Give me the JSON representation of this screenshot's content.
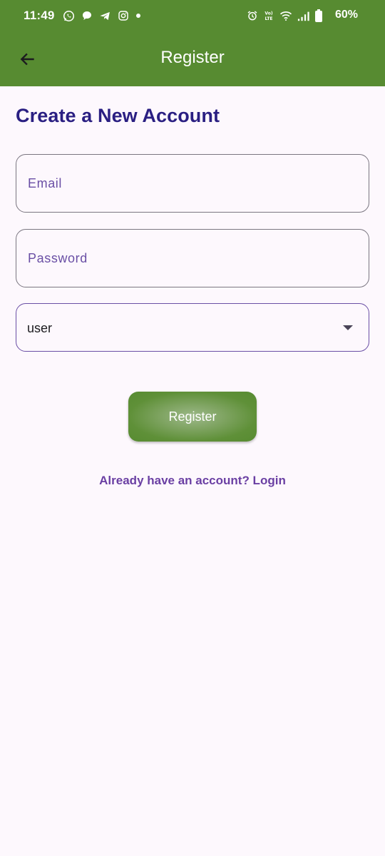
{
  "status_bar": {
    "time": "11:49",
    "battery": "60%",
    "left_icons": [
      "whatsapp-icon",
      "chat-bubble-icon",
      "telegram-icon",
      "instagram-icon",
      "dot-icon"
    ],
    "right_icons": [
      "alarm-icon",
      "volte-icon",
      "wifi-icon",
      "signal-icon",
      "battery-icon"
    ]
  },
  "app_bar": {
    "title": "Register",
    "back_icon": "arrow-back-icon"
  },
  "form": {
    "heading": "Create a New Account",
    "email_placeholder": "Email",
    "password_placeholder": "Password",
    "role_value": "user",
    "register_label": "Register",
    "login_link": "Already have an account? Login"
  },
  "colors": {
    "primary_green": "#578b31",
    "heading_navy": "#2a1f82",
    "accent_purple": "#6a4fa5",
    "background": "#fdf8fd"
  }
}
